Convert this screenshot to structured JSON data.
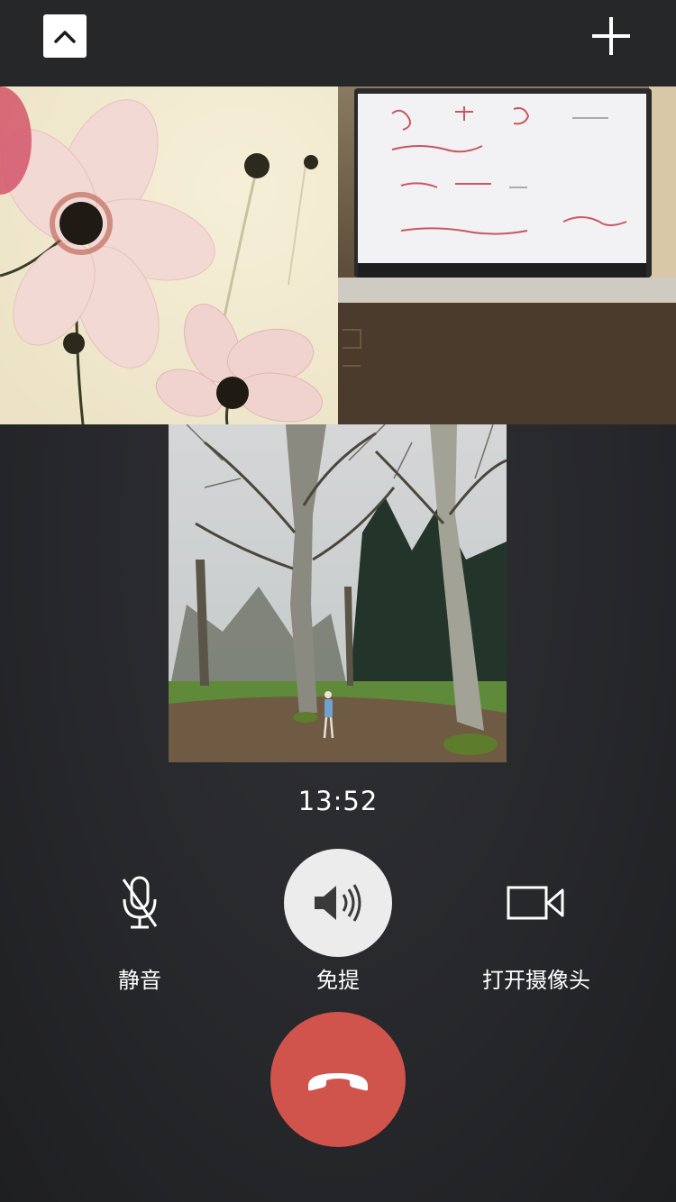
{
  "call": {
    "duration": "13:52"
  },
  "controls": {
    "mute_label": "静音",
    "speaker_label": "免提",
    "camera_label": "打开摄像头"
  },
  "icons": {
    "collapse": "chevron-up-icon",
    "add": "plus-icon",
    "mute": "microphone-off-icon",
    "speaker": "speaker-icon",
    "camera": "video-camera-icon",
    "hangup": "phone-hangup-icon"
  },
  "colors": {
    "background": "#26272a",
    "hangup": "#d0534c",
    "speaker_active": "#ececec"
  },
  "participants": [
    {
      "image": "pink-cosmos-flowers"
    },
    {
      "image": "laptop-screen-math-notes"
    },
    {
      "image": "forest-trees-person"
    }
  ]
}
